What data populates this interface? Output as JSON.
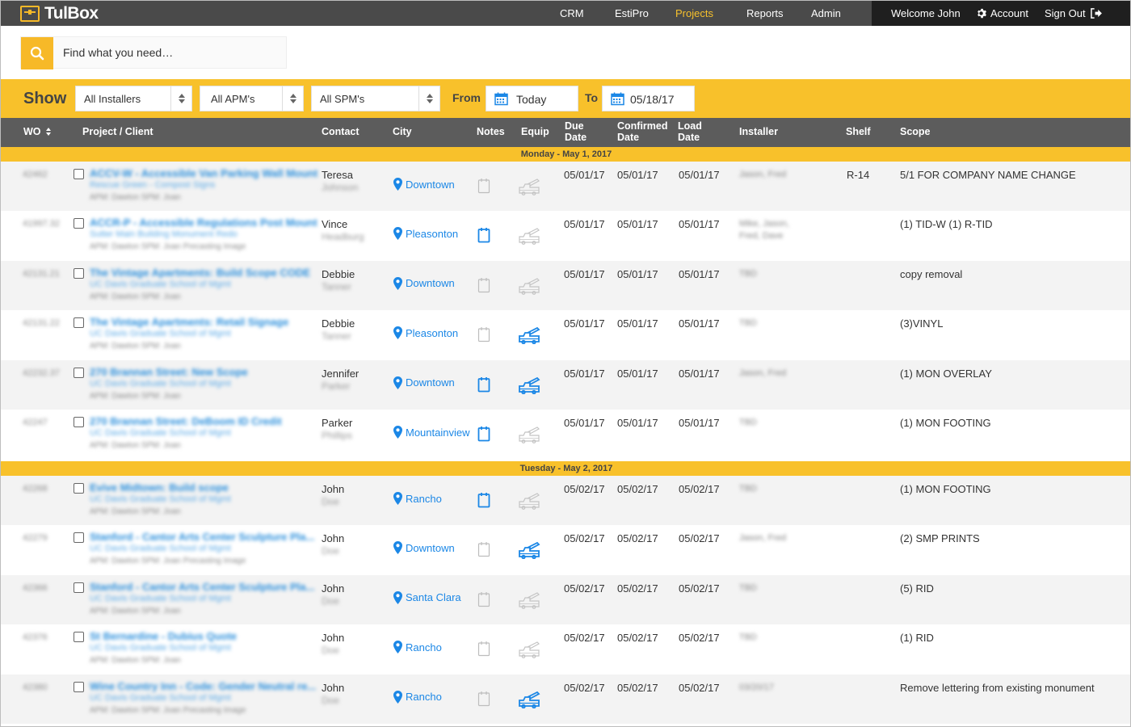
{
  "app": {
    "logo_text": "TulBox",
    "accent": "#f8c12b",
    "link_color": "#1b87e6"
  },
  "nav": {
    "items": [
      {
        "label": "CRM",
        "active": false
      },
      {
        "label": "EstiPro",
        "active": false
      },
      {
        "label": "Projects",
        "active": true
      },
      {
        "label": "Reports",
        "active": false
      },
      {
        "label": "Admin",
        "active": false
      }
    ],
    "welcome": "Welcome John",
    "account": "Account",
    "signout": "Sign Out"
  },
  "search": {
    "placeholder": "Find what you need…",
    "icon": "search-icon"
  },
  "filters": {
    "show_label": "Show",
    "installers": "All Installers",
    "apms": "All APM's",
    "spms": "All SPM's",
    "from_label": "From",
    "from_value": "Today",
    "to_label": "To",
    "to_value": "05/18/17"
  },
  "columns": {
    "wo": "WO",
    "project": "Project / Client",
    "contact": "Contact",
    "city": "City",
    "notes": "Notes",
    "equip": "Equip",
    "due": [
      "Due",
      "Date"
    ],
    "confirmed": [
      "Confirmed",
      "Date"
    ],
    "load": [
      "Load",
      "Date"
    ],
    "installer": "Installer",
    "shelf": "Shelf",
    "scope": "Scope"
  },
  "groups": [
    {
      "day": "Monday - May 1, 2017",
      "rows": [
        {
          "wo": "42462",
          "title": "ACCV-W - Accessible Van Parking Wall Mount",
          "client": "Rescue Green - Compost Signs",
          "meta": "APM: Dawton    SPM: Joan",
          "contact_first": "Teresa",
          "contact_last": "Johnson",
          "city": "Downtown",
          "notes_active": false,
          "equip_active": false,
          "due": "05/01/17",
          "confirmed": "05/01/17",
          "load": "05/01/17",
          "installer": [
            "Jason, Fred"
          ],
          "shelf": "R-14",
          "scope": "5/1 FOR COMPANY NAME CHANGE"
        },
        {
          "wo": "41997.32",
          "title": "ACCR-P - Accessible Regulations Post Mount",
          "client": "Sutter Main Building Monument Redo",
          "meta": "APM: Dawton    SPM: Joan    Precasting Image",
          "contact_first": "Vince",
          "contact_last": "Headburg",
          "city": "Pleasonton",
          "notes_active": true,
          "equip_active": false,
          "due": "05/01/17",
          "confirmed": "05/01/17",
          "load": "05/01/17",
          "installer": [
            "Mike, Jason,",
            "Fred, Dave"
          ],
          "shelf": "",
          "scope": "(1) TID-W (1) R-TID"
        },
        {
          "wo": "42131.21",
          "title": "The Vintage Apartments: Build Scope CODE",
          "client": "UC Davis Graduate School of Mgmt",
          "meta": "APM: Dawton    SPM: Joan",
          "contact_first": "Debbie",
          "contact_last": "Tanner",
          "city": "Downtown",
          "notes_active": false,
          "equip_active": false,
          "due": "05/01/17",
          "confirmed": "05/01/17",
          "load": "05/01/17",
          "installer": [
            "TBD"
          ],
          "shelf": "",
          "scope": "copy removal"
        },
        {
          "wo": "42131.22",
          "title": "The Vintage Apartments: Retail Signage",
          "client": "UC Davis Graduate School of Mgmt",
          "meta": "APM: Dawton    SPM: Joan",
          "contact_first": "Debbie",
          "contact_last": "Tanner",
          "city": "Pleasonton",
          "notes_active": false,
          "equip_active": true,
          "due": "05/01/17",
          "confirmed": "05/01/17",
          "load": "05/01/17",
          "installer": [
            "TBD"
          ],
          "shelf": "",
          "scope": "(3)VINYL"
        },
        {
          "wo": "42232.37",
          "title": "270 Brannan Street: New Scope",
          "client": "UC Davis Graduate School of Mgmt",
          "meta": "APM: Dawton    SPM: Joan",
          "contact_first": "Jennifer",
          "contact_last": "Parker",
          "city": "Downtown",
          "notes_active": true,
          "equip_active": true,
          "due": "05/01/17",
          "confirmed": "05/01/17",
          "load": "05/01/17",
          "installer": [
            "Jason, Fred"
          ],
          "shelf": "",
          "scope": "(1) MON OVERLAY"
        },
        {
          "wo": "42247",
          "title": "270 Brannan Street: DeBoom ID Credit",
          "client": "UC Davis Graduate School of Mgmt",
          "meta": "APM: Dawton    SPM: Joan",
          "contact_first": "Parker",
          "contact_last": "Phillips",
          "city": "Mountainview",
          "notes_active": true,
          "equip_active": false,
          "due": "05/01/17",
          "confirmed": "05/01/17",
          "load": "05/01/17",
          "installer": [
            "TBD"
          ],
          "shelf": "",
          "scope": "(1) MON FOOTING"
        }
      ]
    },
    {
      "day": "Tuesday - May 2, 2017",
      "rows": [
        {
          "wo": "42268",
          "title": "Evive Midtown: Build scope",
          "client": "UC Davis Graduate School of Mgmt",
          "meta": "APM: Dawton    SPM: Joan",
          "contact_first": "John",
          "contact_last": "Doe",
          "city": "Rancho",
          "notes_active": true,
          "equip_active": false,
          "due": "05/02/17",
          "confirmed": "05/02/17",
          "load": "05/02/17",
          "installer": [
            "TBD"
          ],
          "shelf": "",
          "scope": "(1) MON FOOTING"
        },
        {
          "wo": "42279",
          "title": "Stanford - Cantor Arts Center Sculpture Pla...",
          "client": "UC Davis Graduate School of Mgmt",
          "meta": "APM: Dawton    SPM: Joan    Precasting Image",
          "contact_first": "John",
          "contact_last": "Doe",
          "city": "Downtown",
          "notes_active": false,
          "equip_active": true,
          "due": "05/02/17",
          "confirmed": "05/02/17",
          "load": "05/02/17",
          "installer": [
            "Jason, Fred"
          ],
          "shelf": "",
          "scope": "(2) SMP PRINTS"
        },
        {
          "wo": "42366",
          "title": "Stanford - Cantor Arts Center Sculpture Pla...",
          "client": "UC Davis Graduate School of Mgmt",
          "meta": "APM: Dawton    SPM: Joan",
          "contact_first": "John",
          "contact_last": "Doe",
          "city": "Santa Clara",
          "notes_active": false,
          "equip_active": false,
          "due": "05/02/17",
          "confirmed": "05/02/17",
          "load": "05/02/17",
          "installer": [
            "TBD"
          ],
          "shelf": "",
          "scope": "(5) RID"
        },
        {
          "wo": "42376",
          "title": "St Bernardine - Dubius Quote",
          "client": "UC Davis Graduate School of Mgmt",
          "meta": "APM: Dawton    SPM: Joan",
          "contact_first": "John",
          "contact_last": "Doe",
          "city": "Rancho",
          "notes_active": false,
          "equip_active": false,
          "due": "05/02/17",
          "confirmed": "05/02/17",
          "load": "05/02/17",
          "installer": [
            "TBD"
          ],
          "shelf": "",
          "scope": "(1) RID"
        },
        {
          "wo": "42380",
          "title": "Wine Country Inn - Code: Gender Neutral re...",
          "client": "UC Davis Graduate School of Mgmt",
          "meta": "APM: Dawton    SPM: Joan    Precasting Image",
          "contact_first": "John",
          "contact_last": "Doe",
          "city": "Rancho",
          "notes_active": false,
          "equip_active": true,
          "due": "05/02/17",
          "confirmed": "05/02/17",
          "load": "05/02/17",
          "installer": [
            "03/20/17"
          ],
          "shelf": "",
          "scope": "Remove lettering from existing monument"
        }
      ]
    }
  ]
}
